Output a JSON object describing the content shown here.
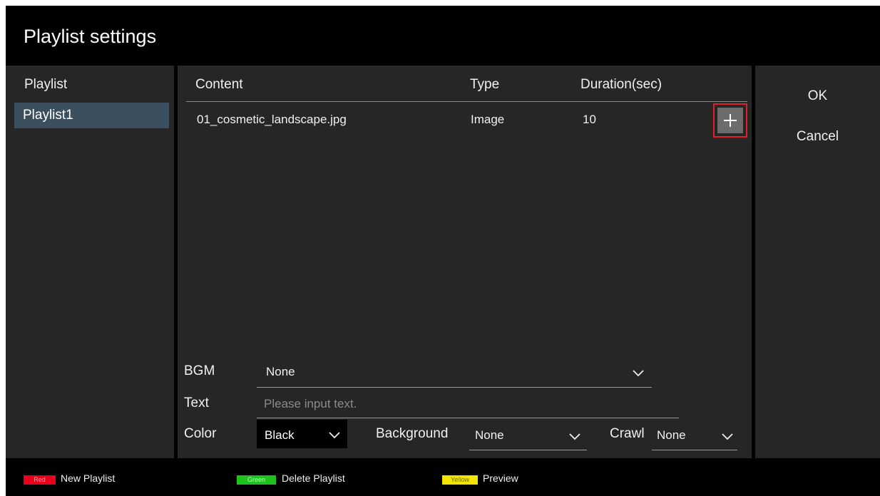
{
  "window": {
    "title": "Playlist settings"
  },
  "playlists": {
    "header": "Playlist",
    "items": [
      {
        "label": "Playlist1",
        "selected": true
      }
    ]
  },
  "content_table": {
    "columns": {
      "content": "Content",
      "type": "Type",
      "duration": "Duration(sec)"
    },
    "rows": [
      {
        "content": "01_cosmetic_landscape.jpg",
        "type": "Image",
        "duration": "10"
      }
    ],
    "add_button_icon": "plus-icon"
  },
  "settings": {
    "bgm": {
      "label": "BGM",
      "value": "None"
    },
    "text": {
      "label": "Text",
      "value": "",
      "placeholder": "Please input text."
    },
    "color": {
      "label": "Color",
      "value": "Black"
    },
    "background": {
      "label": "Background",
      "value": "None"
    },
    "crawl": {
      "label": "Crawl",
      "value": "None"
    }
  },
  "actions": {
    "ok": "OK",
    "cancel": "Cancel"
  },
  "footer": {
    "keys": [
      {
        "key": "Red",
        "label": "New Playlist",
        "color": "#e8001c",
        "text_color": "#ff9a9a"
      },
      {
        "key": "Green",
        "label": "Delete Playlist",
        "color": "#1ec21e",
        "text_color": "#b8ffb8"
      },
      {
        "key": "Yellow",
        "label": "Preview",
        "color": "#f2e500",
        "text_color": "#6e6a00"
      }
    ]
  },
  "colors": {
    "background": "#000000",
    "panel": "#262626",
    "selection": "#3c4f5f",
    "focus_outline": "#e0202a"
  }
}
